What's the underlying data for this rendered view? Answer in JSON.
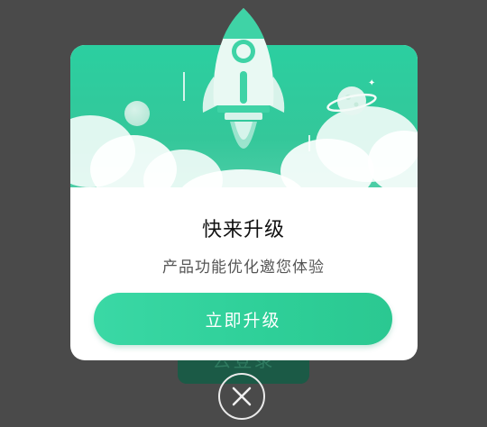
{
  "background": {
    "button_label": "去登录"
  },
  "dialog": {
    "title": "快来升级",
    "subtitle": "产品功能优化邀您体验",
    "upgrade_button_label": "立即升级",
    "hero_illustration": "rocket-icon"
  },
  "close": {
    "icon": "close-icon"
  },
  "colors": {
    "accent": "#2ecf98",
    "hero_green": "#34c79a",
    "overlay": "#4a4a4a"
  }
}
